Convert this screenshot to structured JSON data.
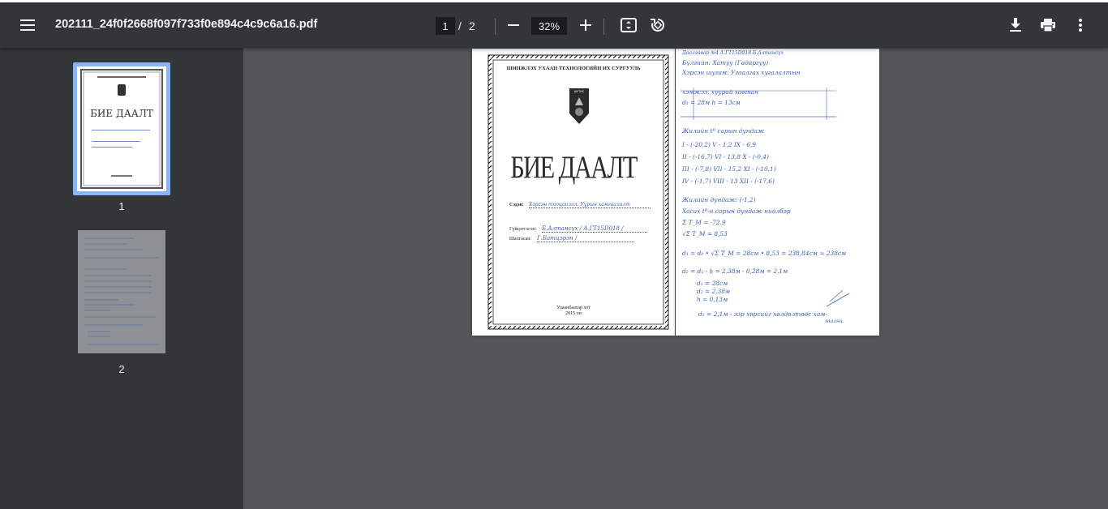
{
  "toolbar": {
    "title": "202111_24f0f2668f097f733f0e894c4c9c6a16.pdf",
    "current_page": "1",
    "page_separator": "/",
    "total_pages": "2",
    "zoom": "32%"
  },
  "sidebar": {
    "thumbnails": [
      {
        "label": "1"
      },
      {
        "label": "2"
      }
    ]
  },
  "page1": {
    "university": "ШИНЖЛЭХ УХААН ТЕХНОЛОГИЙН ИХ СУРГУУЛЬ",
    "emblem_text": "ШУТИС",
    "heading": "БИЕ ДААЛТ",
    "subject_label": "Сэдэв:",
    "subject_value": "Хэрсэн тооцоолол. Уурын хамгаалалт",
    "student_label": "Гүйцэтгэсэн:",
    "student_value": "Б.Алтансүх / А.ГТ15D018 /",
    "teacher_label": "Шалгасан:",
    "teacher_value": "Г.Батцэрэн /",
    "city": "Улаанбаатар хот",
    "year": "2015 он"
  },
  "page2": {
    "lines": [
      "Даалгавар №4           А.ГТ15D018 Б.Алтансүх",
      "Бүлгийн: Хатуу (Гадаргуу)",
      "Хэрсэн шугам: Угаалгах хугалалтын",
      "хэмжээ, хуурай хавтан",
      "d₁ = 28м                 h = 13см",
      "Жилийн tº сарын дундаж",
      "I - (-20,2)   V - 1,2    IX - 6,9",
      "II - (-16,7)  VI - 13,8  X - (-0,4)",
      "III - (-7,8)  VII - 15,2 XI - (-10,1)",
      "IV - (-1,7)   VIII - 13  XII - (-17,6)",
      "Жилийн дундаж: (-1,2)",
      "Хасах tº-н сарын дундаж нийлбэр",
      "Σ T_M = -72,9",
      "√Σ T_M = 8,53",
      "d₁ = d₀ • √Σ T_M = 28см • 8,53 = 238,84см ≈ 238см",
      "d₂ = d₁ - h = 2,38м - 0,28м = 2,1м",
      "d₁ = 28см",
      "d₂ = 2,38м",
      "h = 0,13м",
      "d₂ = 2,1м - ээр хөрсийг хөлдөлтөөс хам-",
      "гаална."
    ]
  },
  "colors": {
    "toolbar_bg": "#323639",
    "viewer_bg": "#525659",
    "thumb_selected": "#8ab4f8",
    "ink_blue": "#3b5fb5"
  }
}
